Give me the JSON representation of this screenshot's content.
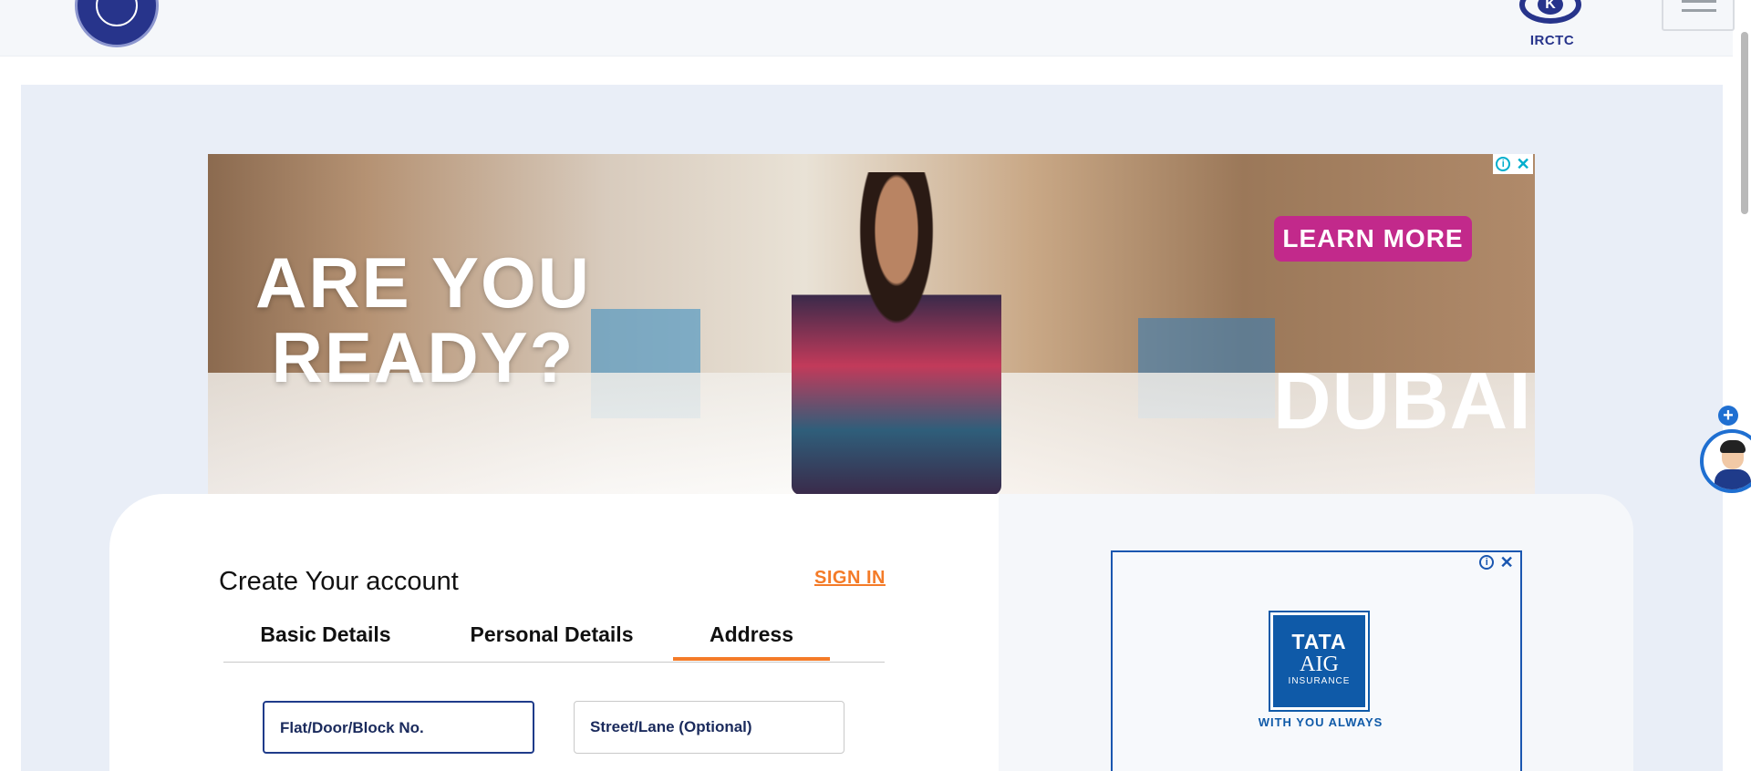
{
  "header": {
    "logo_left_name": "Indian Railways emblem",
    "logo_right_text": "IRCTC",
    "menu_icon": "hamburger-icon"
  },
  "top_ad": {
    "headline_line1": "ARE YOU",
    "headline_line2": "READY?",
    "cta": "LEARN MORE",
    "brand": "DUBAI",
    "info_icon": "info-icon",
    "close_icon": "close-icon"
  },
  "form": {
    "title": "Create Your account",
    "signin_link": "SIGN IN",
    "tabs": [
      {
        "label": "Basic Details",
        "active": false
      },
      {
        "label": "Personal Details",
        "active": false
      },
      {
        "label": "Address",
        "active": true
      }
    ],
    "fields": [
      {
        "placeholder": "Flat/Door/Block No.",
        "value": ""
      },
      {
        "placeholder": "Street/Lane (Optional)",
        "value": ""
      }
    ]
  },
  "side_ad": {
    "brand_line1": "TATA",
    "brand_line2": "AIG",
    "brand_line3": "INSURANCE",
    "tagline": "WITH YOU ALWAYS"
  },
  "chat_widget": {
    "plus_icon": "plus-icon",
    "avatar_icon": "chatbot-avatar-icon"
  },
  "colors": {
    "accent_orange": "#f47b28",
    "brand_blue": "#27348b",
    "page_bg": "#e9eef7",
    "ad_cta_magenta": "#c2298b"
  }
}
